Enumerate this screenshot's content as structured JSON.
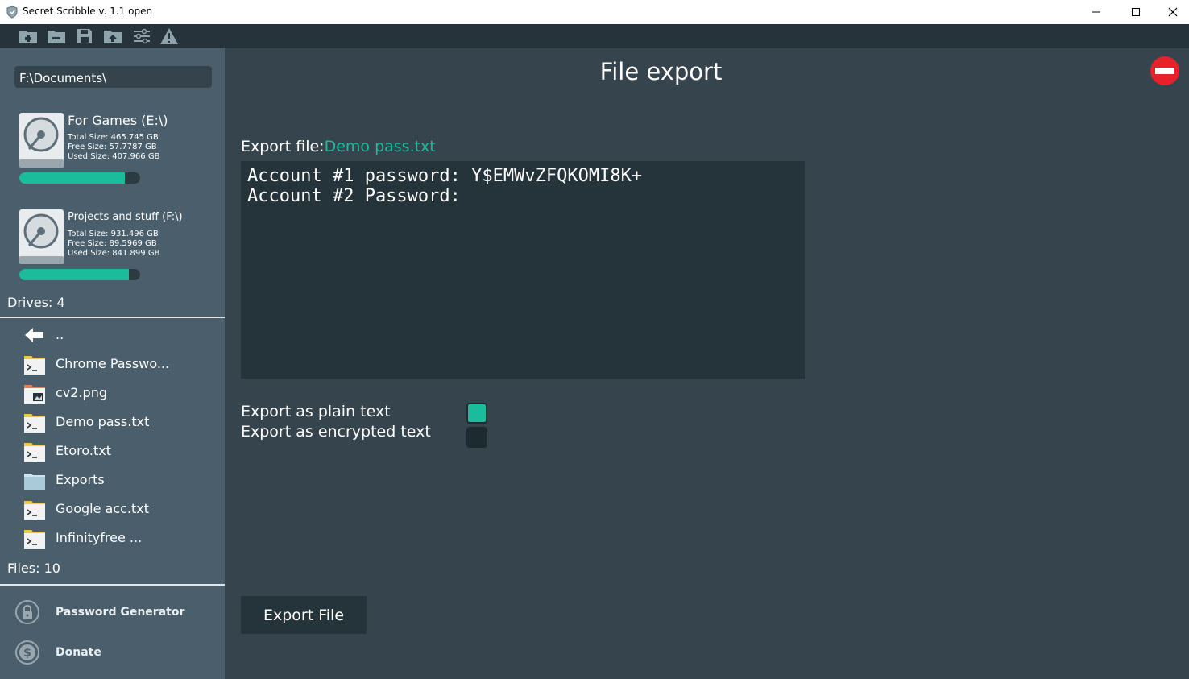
{
  "window": {
    "title": "Secret Scribble v. 1.1 open",
    "minimize_symbol": "—",
    "maximize_symbol": "☐",
    "close_symbol": "✕"
  },
  "toolbar": {
    "icons": [
      "new-folder-icon",
      "remove-folder-icon",
      "save-icon",
      "upload-icon",
      "settings-sliders-icon",
      "warning-icon"
    ]
  },
  "sidebar": {
    "path": "F:\\Documents\\",
    "drives": [
      {
        "name": "For Games (E:\\)",
        "total": "Total Size: 465.745 GB",
        "free": "Free Size: 57.7787 GB",
        "used": "Used Size: 407.966 GB",
        "used_fraction": 0.876
      },
      {
        "name": "Projects and stuff (F:\\)",
        "total": "Total Size: 931.496 GB",
        "free": "Free Size: 89.5969 GB",
        "used": "Used Size: 841.899 GB",
        "used_fraction": 0.904
      }
    ],
    "drives_count": "Drives: 4",
    "files": [
      {
        "name": "..",
        "icon": "back-arrow-icon"
      },
      {
        "name": "Chrome Passwo...",
        "icon": "text-file-icon"
      },
      {
        "name": "cv2.png",
        "icon": "image-file-icon"
      },
      {
        "name": "Demo pass.txt",
        "icon": "text-file-icon"
      },
      {
        "name": "Etoro.txt",
        "icon": "text-file-icon"
      },
      {
        "name": "Exports",
        "icon": "folder-icon"
      },
      {
        "name": "Google acc.txt",
        "icon": "text-file-icon"
      },
      {
        "name": "Infinityfree ...",
        "icon": "text-file-icon"
      }
    ],
    "files_count": "Files: 10",
    "password_generator": "Password Generator",
    "donate": "Donate"
  },
  "main": {
    "title": "File export",
    "export_prefix": "Export file:",
    "export_filename": "Demo pass.txt",
    "content": "Account #1 password: Y$EMWvZFQKOMI8K+\nAccount #2 Password:",
    "plain_label": "Export as plain text",
    "plain_checked": true,
    "encrypted_label": "Export as encrypted text",
    "encrypted_checked": false,
    "export_button": "Export File"
  },
  "colors": {
    "accent": "#1abc9c",
    "sidebar_bg": "#4a5f6b",
    "main_bg": "#36444e",
    "toolbar_bg": "#27333b",
    "danger": "#e8202a"
  }
}
